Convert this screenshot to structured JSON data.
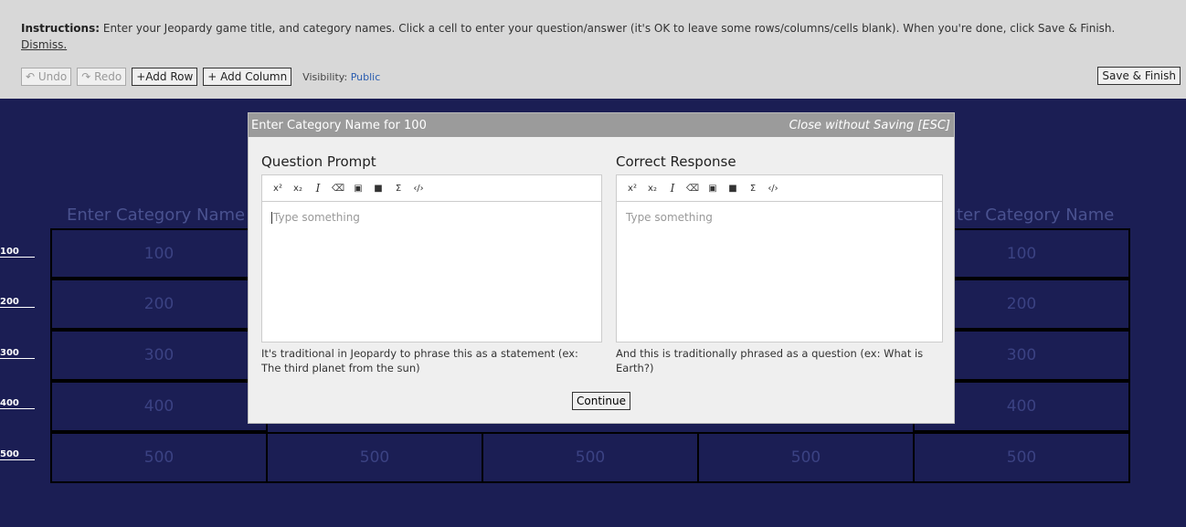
{
  "toolbar": {
    "instructions_label": "Instructions:",
    "instructions_text": " Enter your Jeopardy game title, and category names. Click a cell to enter your question/answer (it's OK to leave some rows/columns/cells blank). When you're done, click Save & Finish.",
    "dismiss": "Dismiss.",
    "undo": "↶ Undo",
    "redo": "↷ Redo",
    "add_row": "+Add Row",
    "add_column": "+ Add Column",
    "visibility_label": "Visibility:",
    "visibility_value": "Public",
    "save_finish": "Save & Finish"
  },
  "board": {
    "category_placeholder": "Enter Category Name",
    "category_right": "ter Category Name",
    "rows": [
      "100",
      "200",
      "300",
      "400",
      "500"
    ]
  },
  "modal": {
    "title": "Enter Category Name for 100",
    "close": "Close without Saving [ESC]",
    "question_title": "Question Prompt",
    "question_placeholder": "Type something",
    "question_hint": "It's traditional in Jeopardy to phrase this as a statement (ex: The third planet from the sun)",
    "answer_title": "Correct Response",
    "answer_placeholder": "Type something",
    "answer_hint": "And this is traditionally phrased as a question (ex: What is Earth?)",
    "continue": "Continue",
    "tools": [
      "x²",
      "x₂",
      "I",
      "⌫",
      "▣",
      "■",
      "Σ",
      "‹/›"
    ]
  }
}
